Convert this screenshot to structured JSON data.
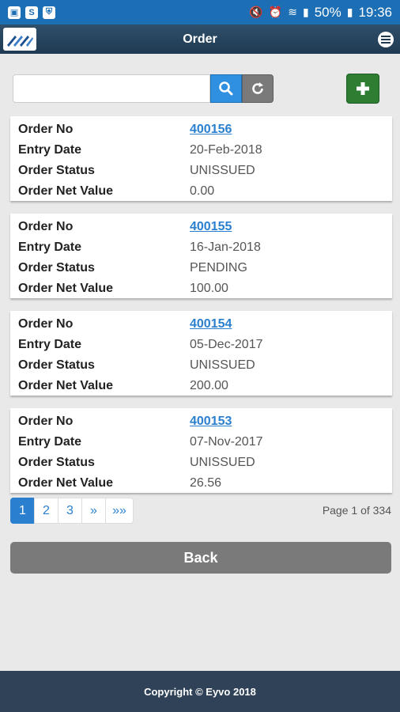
{
  "status_bar": {
    "battery": "50%",
    "time": "19:36"
  },
  "header": {
    "title": "Order",
    "logo_icon": "eyvo-logo-icon",
    "menu_icon": "hamburger-menu-icon"
  },
  "search": {
    "value": "",
    "placeholder": ""
  },
  "orders": [
    {
      "order_no_label": "Order No",
      "order_no": "400156",
      "entry_date_label": "Entry Date",
      "entry_date": "20-Feb-2018",
      "status_label": "Order Status",
      "status": "UNISSUED",
      "net_value_label": "Order Net Value",
      "net_value": "0.00"
    },
    {
      "order_no_label": "Order No",
      "order_no": "400155",
      "entry_date_label": "Entry Date",
      "entry_date": "16-Jan-2018",
      "status_label": "Order Status",
      "status": "PENDING",
      "net_value_label": "Order Net Value",
      "net_value": "100.00"
    },
    {
      "order_no_label": "Order No",
      "order_no": "400154",
      "entry_date_label": "Entry Date",
      "entry_date": "05-Dec-2017",
      "status_label": "Order Status",
      "status": "UNISSUED",
      "net_value_label": "Order Net Value",
      "net_value": "200.00"
    },
    {
      "order_no_label": "Order No",
      "order_no": "400153",
      "entry_date_label": "Entry Date",
      "entry_date": "07-Nov-2017",
      "status_label": "Order Status",
      "status": "UNISSUED",
      "net_value_label": "Order Net Value",
      "net_value": "26.56"
    }
  ],
  "pagination": {
    "pages": [
      "1",
      "2",
      "3"
    ],
    "next": "»",
    "last": "»»",
    "page_info": "Page 1 of 334"
  },
  "back_label": "Back",
  "footer": {
    "copyright": "Copyright © Eyvo 2018"
  },
  "colors": {
    "status_bar": "#1c6fb5",
    "header": "#2f4f6a",
    "accent": "#2a7fcf",
    "add": "#2e7d32",
    "back": "#7a7a7a",
    "footer": "#2f4257"
  }
}
